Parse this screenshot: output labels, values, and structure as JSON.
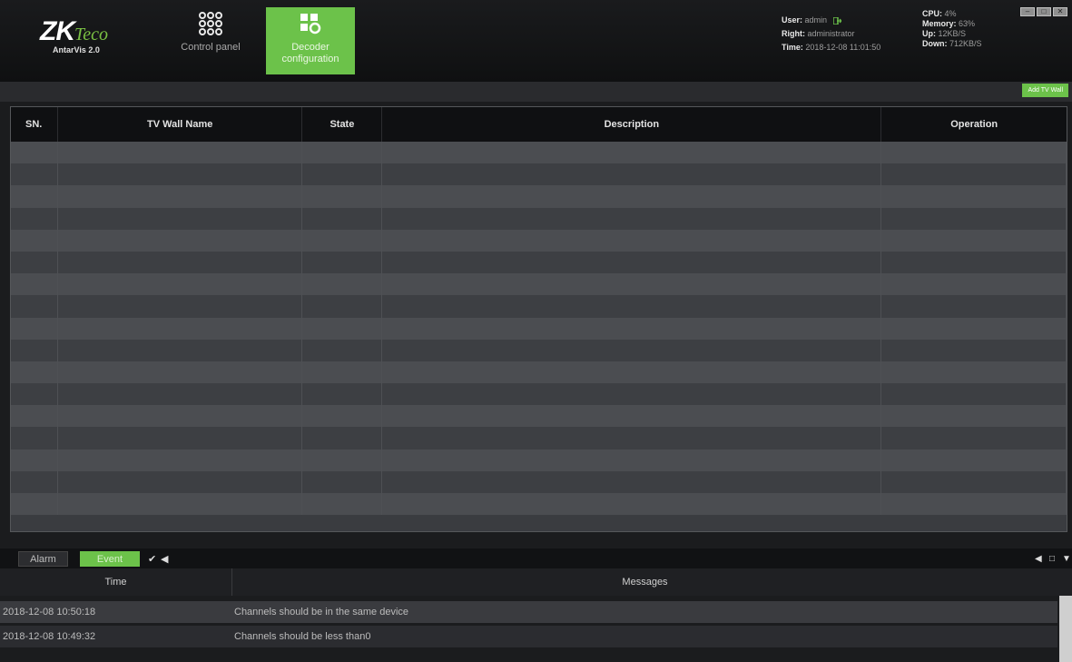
{
  "app": {
    "logo_main": "ZK",
    "logo_sub": "Teco",
    "product": "AntarVis 2.0"
  },
  "nav": {
    "control_panel": "Control panel",
    "decoder_configuration": "Decoder configuration"
  },
  "user": {
    "user_label": "User:",
    "user_value": "admin",
    "right_label": "Right:",
    "right_value": "administrator",
    "time_label": "Time:",
    "time_value": "2018-12-08 11:01:50"
  },
  "system": {
    "cpu_label": "CPU:",
    "cpu_value": "4%",
    "memory_label": "Memory:",
    "memory_value": "63%",
    "up_label": "Up:",
    "up_value": "12KB/S",
    "down_label": "Down:",
    "down_value": "712KB/S"
  },
  "toolbar": {
    "add_button": "Add TV Wall"
  },
  "table": {
    "columns": [
      "SN.",
      "TV Wall Name",
      "State",
      "Description",
      "Operation"
    ],
    "empty_rows": 17
  },
  "bottom": {
    "tab_alarm": "Alarm",
    "tab_event": "Event",
    "columns": [
      "Time",
      "Messages"
    ],
    "logs": [
      {
        "time": "2018-12-08 10:50:18",
        "message": "Channels should be in the same device"
      },
      {
        "time": "2018-12-08 10:49:32",
        "message": "Channels should be less than0"
      }
    ]
  },
  "colors": {
    "accent": "#6cc24a",
    "header_bg": "#111214",
    "row_light": "#4b4d51",
    "row_dark": "#3d3f43"
  },
  "icons": [
    "control-panel-icon",
    "decoder-icon",
    "logout-icon",
    "minimize-icon",
    "restore-icon",
    "close-icon",
    "clear-icon",
    "sound-icon",
    "pin-icon",
    "float-icon",
    "collapse-icon"
  ]
}
